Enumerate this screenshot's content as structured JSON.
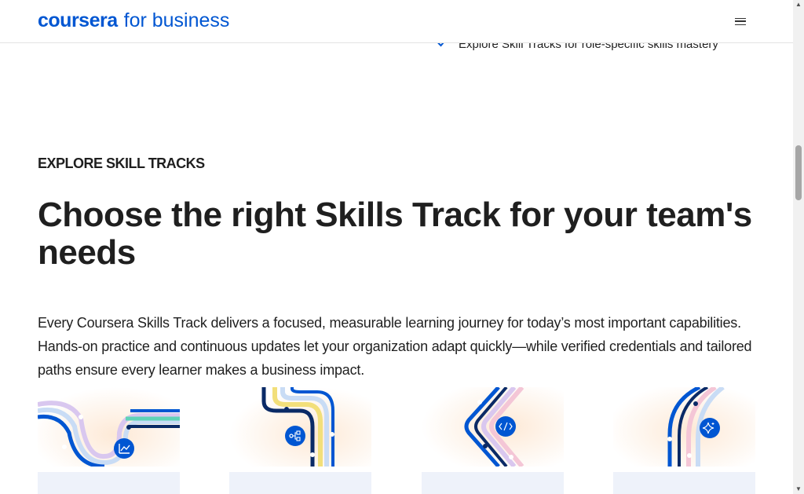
{
  "header": {
    "logo_brand": "coursera",
    "logo_suffix": "for business",
    "menu_icon": "hamburger-menu-icon"
  },
  "feature_bullet": {
    "icon": "checkmark-icon",
    "text": "Explore Skill Tracks for role-specific skills mastery"
  },
  "section": {
    "eyebrow": "EXPLORE SKILL TRACKS",
    "headline": "Choose the right Skills Track for your team's needs",
    "description": "Every Coursera Skills Track delivers a focused, measurable learning journey for today’s most important capabilities. Hands-on practice and continuous updates let your organization adapt quickly—while verified credentials and tailored paths ensure every learner makes a business impact."
  },
  "cards": [
    {
      "icon": "chart-icon"
    },
    {
      "icon": "network-icon"
    },
    {
      "icon": "code-icon"
    },
    {
      "icon": "sparkle-ai-icon"
    }
  ],
  "colors": {
    "brand_blue": "#0056d2",
    "navy": "#0a2a66",
    "light_blue": "#c9dcf5",
    "teal": "#5fd3b8",
    "yellow": "#f2df7a",
    "lavender": "#d9c7ef",
    "pink": "#f4c6d6",
    "card_footer": "#eef2fa"
  }
}
